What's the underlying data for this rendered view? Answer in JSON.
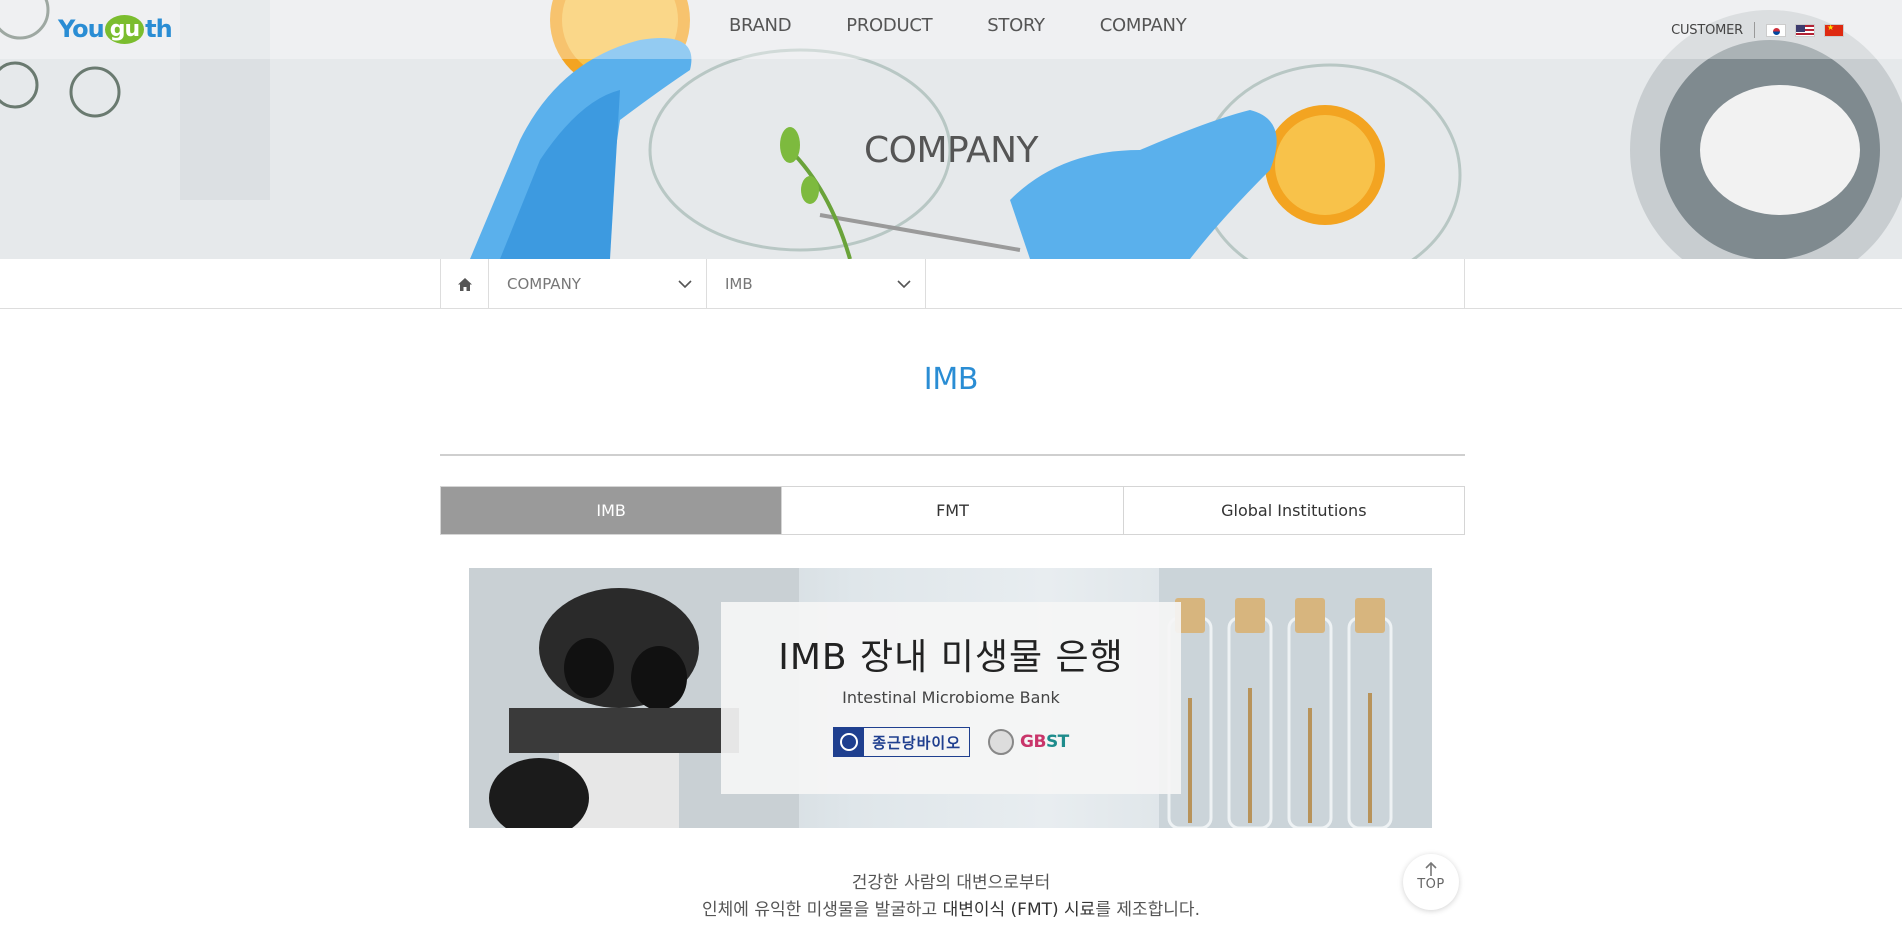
{
  "header": {
    "logo": {
      "part1": "You",
      "part2": "gu",
      "part3": "th"
    },
    "nav": [
      "BRAND",
      "PRODUCT",
      "STORY",
      "COMPANY"
    ],
    "customer": "CUSTOMER",
    "languages": [
      "kr-flag-icon",
      "us-flag-icon",
      "cn-flag-icon"
    ]
  },
  "hero": {
    "title": "COMPANY"
  },
  "breadcrumb": {
    "home_icon": "home-icon",
    "level1": "COMPANY",
    "level2": "IMB"
  },
  "page": {
    "heading": "IMB"
  },
  "tabs": [
    {
      "label": "IMB",
      "active": true
    },
    {
      "label": "FMT",
      "active": false
    },
    {
      "label": "Global Institutions",
      "active": false
    }
  ],
  "banner": {
    "title": "IMB 장내 미생물 은행",
    "subtitle": "Intestinal Microbiome Bank",
    "logo1": "종근당바이오",
    "logo2": {
      "a": "GB",
      "b": "ST"
    }
  },
  "description": {
    "line1": "건강한 사람의 대변으로부터",
    "line2a": "인체에 유익한 미생물을 발굴하고 ",
    "line2b": "대변이식 (FMT) 시료",
    "line2c": "를 제조합니다."
  },
  "top_button": {
    "label": "TOP"
  },
  "colors": {
    "accent": "#2a8dd4",
    "tab_active": "#9a9a9a",
    "brand_green": "#7bbd2e"
  }
}
